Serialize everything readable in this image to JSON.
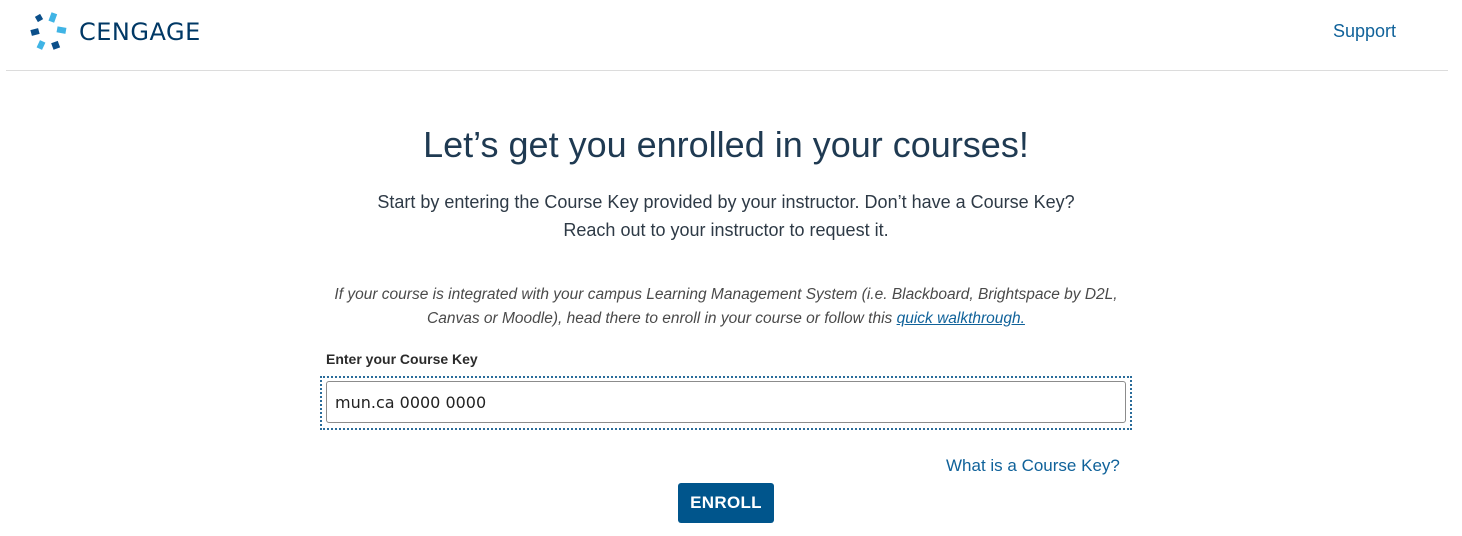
{
  "header": {
    "brand_name": "CENGAGE",
    "support_label": "Support",
    "logo_icon": "cengage-logo-icon"
  },
  "main": {
    "title": "Let’s get you enrolled in your courses!",
    "intro_line1": "Start by entering the Course Key provided by your instructor. Don’t have a Course Key?",
    "intro_line2": "Reach out to your instructor to request it.",
    "lms_note_line1": "If your course is integrated with your campus Learning Management System (i.e. Blackboard, Brightspace by D2L,",
    "lms_note_line2_prefix": "Canvas or Moodle), head there to enroll in your course or follow this ",
    "lms_note_link": "quick walkthrough.",
    "course_key_label": "Enter your Course Key",
    "course_key_value": "mun.ca 0000 0000",
    "what_is_link": "What is a Course Key?",
    "enroll_label": "ENROLL"
  },
  "colors": {
    "brand_dark": "#003865",
    "brand_light": "#40b4e5",
    "link": "#10629a",
    "button_bg": "#00558c"
  }
}
